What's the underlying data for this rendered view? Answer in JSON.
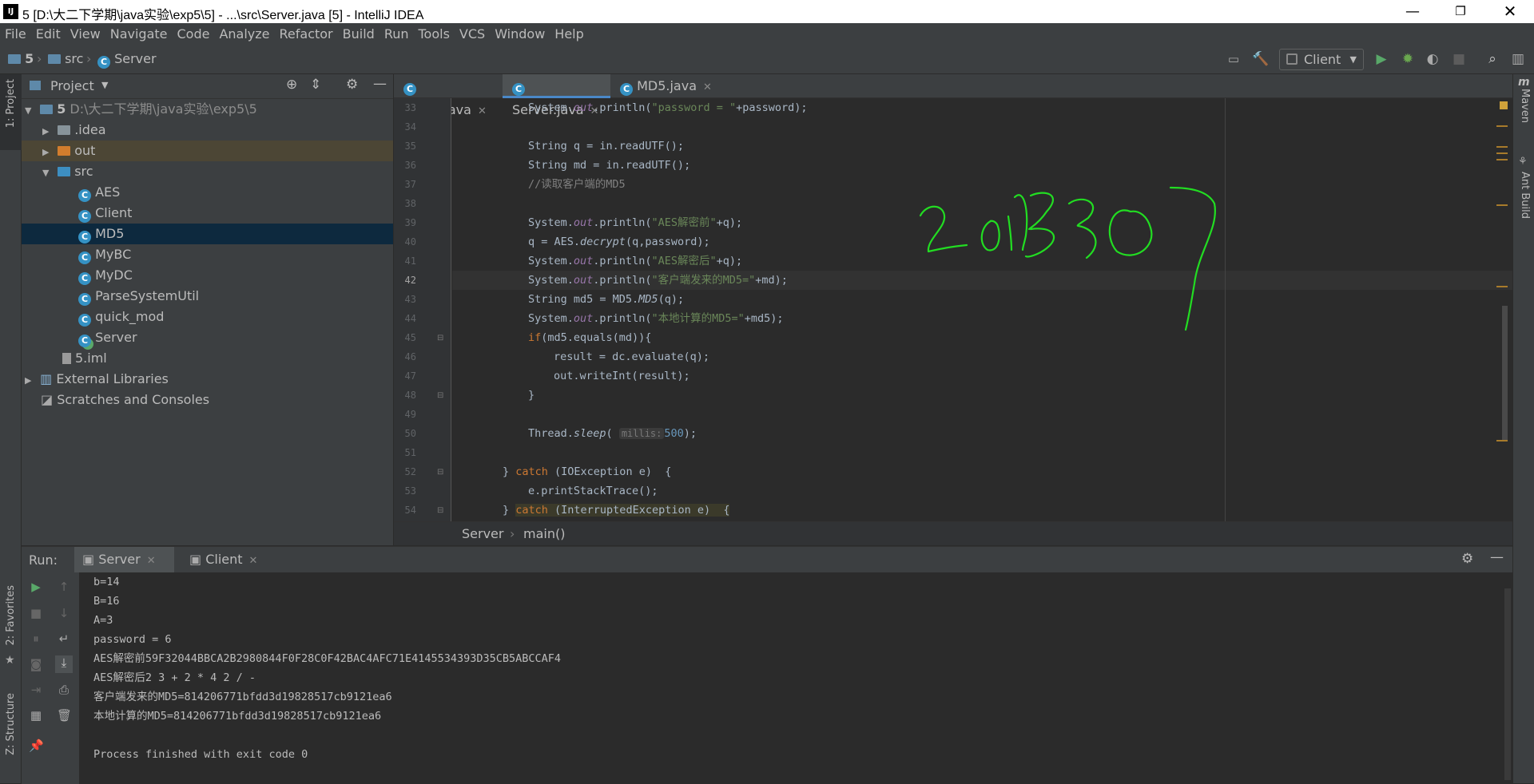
{
  "window": {
    "title": "5 [D:\\大二下学期\\java实验\\exp5\\5] - ...\\src\\Server.java [5] - IntelliJ IDEA",
    "logo": "IJ"
  },
  "menu": [
    "File",
    "Edit",
    "View",
    "Navigate",
    "Code",
    "Analyze",
    "Refactor",
    "Build",
    "Run",
    "Tools",
    "VCS",
    "Window",
    "Help"
  ],
  "nav": {
    "project": "5",
    "folder": "src",
    "file": "Server",
    "run_config": "Client"
  },
  "left_strip": {
    "project_label": "1: Project",
    "favorites_label": "2: Favorites",
    "structure_label": "Z: Structure"
  },
  "right_strip": {
    "maven_label": "Maven",
    "ant_label": "Ant Build"
  },
  "project_panel": {
    "title": "Project",
    "root_name": "5",
    "root_path": "D:\\大二下学期\\java实验\\exp5\\5",
    "items": [
      {
        "label": ".idea"
      },
      {
        "label": "out"
      },
      {
        "label": "src"
      },
      {
        "label": "AES"
      },
      {
        "label": "Client"
      },
      {
        "label": "MD5"
      },
      {
        "label": "MyBC"
      },
      {
        "label": "MyDC"
      },
      {
        "label": "ParseSystemUtil"
      },
      {
        "label": "quick_mod"
      },
      {
        "label": "Server"
      },
      {
        "label": "5.iml"
      },
      {
        "label": "External Libraries"
      },
      {
        "label": "Scratches and Consoles"
      }
    ]
  },
  "editor": {
    "tabs": [
      {
        "label": "Client.java"
      },
      {
        "label": "Server.java"
      },
      {
        "label": "MD5.java"
      }
    ],
    "line_numbers": [
      "33",
      "34",
      "35",
      "36",
      "37",
      "38",
      "39",
      "40",
      "41",
      "42",
      "43",
      "44",
      "45",
      "46",
      "47",
      "48",
      "49",
      "50",
      "51",
      "52",
      "53",
      "54"
    ],
    "code": {
      "l33a": "System.",
      "l33b": "out",
      "l33c": ".println(",
      "l33d": "\"password = \"",
      "l33e": "+password);",
      "l35a": "String q = in.readUTF();",
      "l36a": "String md = in.readUTF();",
      "l37a": "//读取客户端的MD5",
      "l39a": "System.",
      "l39b": "out",
      "l39c": ".println(",
      "l39d": "\"AES解密前\"",
      "l39e": "+q);",
      "l40a": "q = AES.",
      "l40b": "decrypt",
      "l40c": "(q,password);",
      "l41a": "System.",
      "l41b": "out",
      "l41c": ".println(",
      "l41d": "\"AES解密后\"",
      "l41e": "+q);",
      "l42a": "System.",
      "l42b": "out",
      "l42c": ".println(",
      "l42d": "\"客户端发来的MD5=\"",
      "l42e": "+md);",
      "l43a": "String md5 = MD5.",
      "l43b": "MD5",
      "l43c": "(q);",
      "l44a": "System.",
      "l44b": "out",
      "l44c": ".println(",
      "l44d": "\"本地计算的MD5=\"",
      "l44e": "+md5);",
      "l45a": "if",
      "l45b": "(md5.equals(md)){",
      "l46a": "result = dc.evaluate(q);",
      "l47a": "out",
      "l47b": ".writeInt(result);",
      "l48a": "}",
      "l50a": "Thread.",
      "l50b": "sleep",
      "l50c": "( ",
      "l50d": "millis:",
      "l50e": "500",
      "l50f": ");",
      "l52a": "} ",
      "l52b": "catch",
      "l52c": " (IOException e)  {",
      "l53a": "e.printStackTrace();",
      "l54a": "} ",
      "l54b": "catch",
      "l54c": " (InterruptedException e)  {"
    },
    "breadcrumb": {
      "class": "Server",
      "method": "main()"
    }
  },
  "run_panel": {
    "label": "Run:",
    "tabs": [
      {
        "label": "Server"
      },
      {
        "label": "Client"
      }
    ],
    "output": [
      "b=14",
      "B=16",
      "A=3",
      "password = 6",
      "AES解密前59F32044BBCA2B2980844F0F28C0F42BAC4AFC71E4145534393D35CB5ABCCAF4",
      "AES解密后2 3 + 2 * 4 2 / -",
      "客户端发来的MD5=814206771bfdd3d19828517cb9121ea6",
      "本地计算的MD5=814206771bfdd3d19828517cb9121ea6",
      "",
      "Process finished with exit code 0"
    ]
  },
  "annotation": {
    "color": "#22dd22"
  },
  "colors": {
    "bg": "#2b2b2b",
    "panel": "#3c3f41",
    "selection": "#0d293e",
    "keyword": "#cc7832",
    "string": "#6a8759",
    "field": "#9876aa"
  }
}
